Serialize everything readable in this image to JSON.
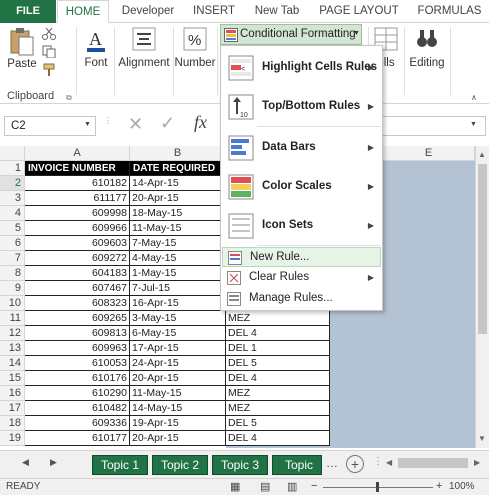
{
  "tabs": [
    "FILE",
    "HOME",
    "Developer",
    "INSERT",
    "New Tab",
    "PAGE LAYOUT",
    "FORMULAS"
  ],
  "ribbon": {
    "paste": "Paste",
    "clipboard": "Clipboard",
    "font": "Font",
    "alignment": "Alignment",
    "number": "Number",
    "cf_button": "Conditional Formatting",
    "cells": "ells",
    "editing": "Editing"
  },
  "formula_bar": {
    "name_box": "C2",
    "fx": "fx",
    "formula": ""
  },
  "columns": [
    "A",
    "B",
    "E"
  ],
  "headers": {
    "invoice": "INVOICE NUMBER",
    "date": "DATE REQUIRED"
  },
  "rows": [
    {
      "n": "1"
    },
    {
      "n": "2",
      "a": "610182",
      "b": "14-Apr-15",
      "c": ""
    },
    {
      "n": "3",
      "a": "611177",
      "b": "20-Apr-15",
      "c": ""
    },
    {
      "n": "4",
      "a": "609998",
      "b": "18-May-15",
      "c": ""
    },
    {
      "n": "5",
      "a": "609966",
      "b": "11-May-15",
      "c": ""
    },
    {
      "n": "6",
      "a": "609603",
      "b": "7-May-15",
      "c": ""
    },
    {
      "n": "7",
      "a": "609272",
      "b": "4-May-15",
      "c": ""
    },
    {
      "n": "8",
      "a": "604183",
      "b": "1-May-15",
      "c": ""
    },
    {
      "n": "9",
      "a": "607467",
      "b": "7-Jul-15",
      "c": ""
    },
    {
      "n": "10",
      "a": "608323",
      "b": "16-Apr-15",
      "c": ""
    },
    {
      "n": "11",
      "a": "609265",
      "b": "3-May-15",
      "c": "MEZ"
    },
    {
      "n": "12",
      "a": "609813",
      "b": "6-May-15",
      "c": "DEL 4"
    },
    {
      "n": "13",
      "a": "609963",
      "b": "17-Apr-15",
      "c": "DEL 1"
    },
    {
      "n": "14",
      "a": "610053",
      "b": "24-Apr-15",
      "c": "DEL 5"
    },
    {
      "n": "15",
      "a": "610176",
      "b": "20-Apr-15",
      "c": "DEL 4"
    },
    {
      "n": "16",
      "a": "610290",
      "b": "11-May-15",
      "c": "MEZ"
    },
    {
      "n": "17",
      "a": "610482",
      "b": "14-May-15",
      "c": "MEZ"
    },
    {
      "n": "18",
      "a": "609336",
      "b": "19-Apr-15",
      "c": "DEL 5"
    },
    {
      "n": "19",
      "a": "610177",
      "b": "20-Apr-15",
      "c": "DEL 4"
    }
  ],
  "menu": [
    "Highlight Cells Rules",
    "Top/Bottom Rules",
    "Data Bars",
    "Color Scales",
    "Icon Sets",
    "New Rule...",
    "Clear Rules",
    "Manage Rules..."
  ],
  "sheets": [
    "Topic 1",
    "Topic 2",
    "Topic 3",
    "Topic 4"
  ],
  "status": {
    "ready": "READY",
    "zoom": "100%"
  },
  "colors": {
    "excel_green": "#217346",
    "highlight": "#e8f3e8",
    "selection_blue": "#b4c3d4"
  }
}
